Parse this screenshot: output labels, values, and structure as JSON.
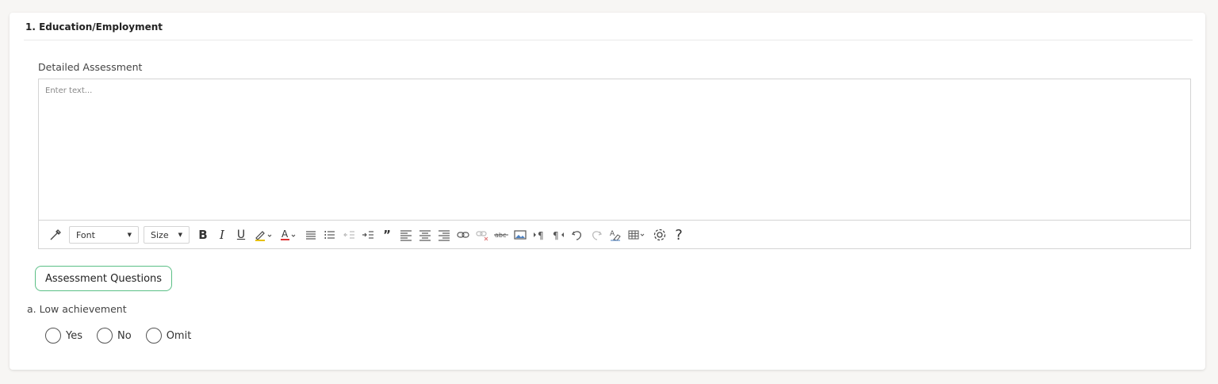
{
  "section": {
    "title": "1. Education/Employment"
  },
  "detailed_assessment": {
    "label": "Detailed Assessment",
    "placeholder": "Enter text..."
  },
  "toolbar": {
    "font_select": "Font",
    "size_select": "Size",
    "bold": "B",
    "italic": "I",
    "underline": "U",
    "font_color": "A",
    "blockquote": "”",
    "help": "?",
    "icons": [
      "magic-format-icon",
      "highlight-icon",
      "font-color-icon",
      "bullet-list-icon",
      "numbered-list-icon",
      "outdent-icon",
      "indent-icon",
      "blockquote-icon",
      "align-left-icon",
      "align-center-icon",
      "align-right-icon",
      "link-icon",
      "unlink-icon",
      "strikethrough-icon",
      "image-icon",
      "ltr-icon",
      "rtl-icon",
      "undo-icon",
      "redo-icon",
      "clear-format-icon",
      "table-icon",
      "settings-icon",
      "help-icon"
    ]
  },
  "assessment_questions": {
    "button_label": "Assessment Questions",
    "accent_color": "#5bbf86"
  },
  "questions": [
    {
      "label": "a. Low achievement",
      "options": [
        "Yes",
        "No",
        "Omit"
      ]
    }
  ]
}
